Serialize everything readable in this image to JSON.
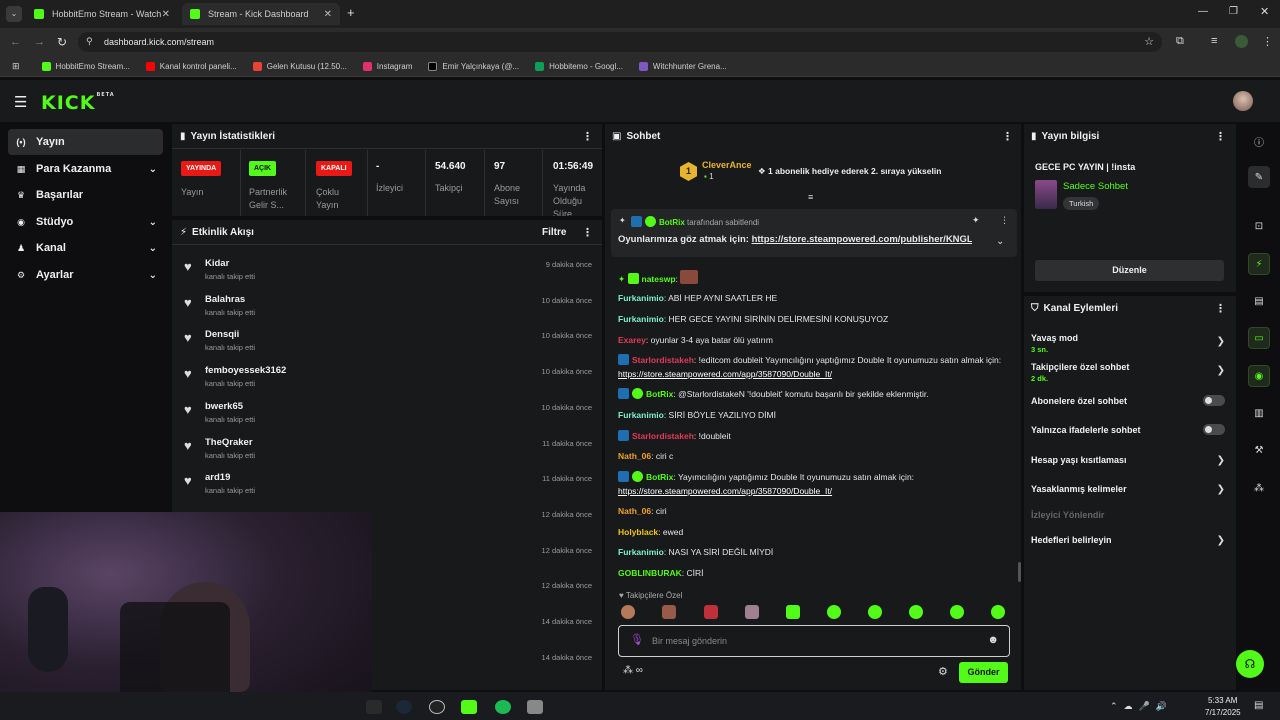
{
  "browser": {
    "tabs": [
      {
        "title": "HobbitEmo Stream - Watch Liv",
        "active": false
      },
      {
        "title": "Stream - Kick Dashboard",
        "active": true
      }
    ],
    "new_tab": "+",
    "url": "dashboard.kick.com/stream",
    "bookmarks": [
      {
        "label": "HobbitEmo Stream...",
        "color": "#53fc18"
      },
      {
        "label": "Kanal kontrol paneli...",
        "color": "#ff0000"
      },
      {
        "label": "Gelen Kutusu (12.50...",
        "color": "#ea4335"
      },
      {
        "label": "Instagram",
        "color": "#e1306c"
      },
      {
        "label": "Emir Yalçınkaya (@...",
        "color": "#000000"
      },
      {
        "label": "Hobbitemo - Googl...",
        "color": "#0f9d58"
      },
      {
        "label": "Witchhunter Grena...",
        "color": "#7e57c2"
      }
    ]
  },
  "kick": {
    "logo": "KICK",
    "logo_beta": "BETA",
    "accent": "#53fc18"
  },
  "nav": [
    {
      "label": "Yayın",
      "icon": "broadcast-icon",
      "glyph": "(•)",
      "active": true,
      "expand": false
    },
    {
      "label": "Para Kazanma",
      "icon": "money-icon",
      "glyph": "▦",
      "active": false,
      "expand": true
    },
    {
      "label": "Başarılar",
      "icon": "trophy-icon",
      "glyph": "🏆",
      "active": false,
      "expand": false
    },
    {
      "label": "Stüdyo",
      "icon": "studio-icon",
      "glyph": "◉",
      "active": false,
      "expand": true
    },
    {
      "label": "Kanal",
      "icon": "channel-icon",
      "glyph": "♟",
      "active": false,
      "expand": true
    },
    {
      "label": "Ayarlar",
      "icon": "settings-icon",
      "glyph": "⚙",
      "active": false,
      "expand": true
    }
  ],
  "stats": {
    "title": "Yayın İstatistikleri",
    "items": [
      {
        "badge": "YAYINDA",
        "badge_color": "#e91916",
        "label": "Yayın"
      },
      {
        "badge": "AÇIK",
        "badge_color": "#53fc18",
        "label": "Partnerlik Gelir S..."
      },
      {
        "badge": "KAPALI",
        "badge_color": "#e91916",
        "label": "Çoklu Yayın"
      },
      {
        "value": "-",
        "label": "İzleyici"
      },
      {
        "value": "54.640",
        "label": "Takipçi"
      },
      {
        "value": "97",
        "label": "Abone Sayısı"
      },
      {
        "value": "01:56:49",
        "label": "Yayında Olduğu Süre"
      }
    ]
  },
  "activity": {
    "title": "Etkinlik Akışı",
    "filter": "Filtre",
    "items": [
      {
        "name": "Kidar",
        "sub": "kanalı takip etti",
        "time": "9 dakika önce"
      },
      {
        "name": "Balahras",
        "sub": "kanalı takip etti",
        "time": "10 dakika önce"
      },
      {
        "name": "Densqii",
        "sub": "kanalı takip etti",
        "time": "10 dakika önce"
      },
      {
        "name": "femboyessek3162",
        "sub": "kanalı takip etti",
        "time": "10 dakika önce"
      },
      {
        "name": "bwerk65",
        "sub": "kanalı takip etti",
        "time": "10 dakika önce"
      },
      {
        "name": "TheQraker",
        "sub": "kanalı takip etti",
        "time": "11 dakika önce"
      },
      {
        "name": "ard19",
        "sub": "kanalı takip etti",
        "time": "11 dakika önce"
      },
      {
        "name": "",
        "sub": "",
        "time": "12 dakika önce"
      },
      {
        "name": "",
        "sub": "",
        "time": "12 dakika önce"
      },
      {
        "name": "",
        "sub": "",
        "time": "12 dakika önce"
      },
      {
        "name": "",
        "sub": "",
        "time": "14 dakika önce"
      },
      {
        "name": "",
        "sub": "",
        "time": "14 dakika önce"
      }
    ]
  },
  "chat": {
    "title": "Sohbet",
    "gift": {
      "rank": "1",
      "user": "CleverAnce",
      "count": "1",
      "text": "1 abonelik hediye ederek 2. sıraya yükselin"
    },
    "pinned": {
      "by": "BotRix",
      "by_suffix": "tarafından sabitlendi",
      "text": "Oyunlarımıza göz atmak için:",
      "link": "https://store.steampowered.com/publisher/KNGL"
    },
    "messages": [
      {
        "user": "nateswp",
        "color": "#53fc18",
        "text": ""
      },
      {
        "user": "Furkanimio",
        "color": "#7bf2c9",
        "text": "ABİ HEP AYNI SAATLER HE"
      },
      {
        "user": "Furkanimio",
        "color": "#7bf2c9",
        "text": "HER GECE YAYINI SİRİNİN DELİRMESİNİ KONUŞUYOZ"
      },
      {
        "user": "Exarey",
        "color": "#e33a5a",
        "text": "oyunlar 3-4 aya batar ölü yatırım"
      },
      {
        "user": "Starlordistakeh",
        "color": "#e33a5a",
        "text": "!editcom doubleit Yayımcılığını yaptığımız Double It oyunumuzu satın almak için:",
        "link": "https://store.steampowered.com/app/3587090/Double_It/"
      },
      {
        "user": "BotRix",
        "color": "#53fc18",
        "text": "@StarlordistakeN '!doubleit' komutu başarılı bir şekilde eklenmiştir."
      },
      {
        "user": "Furkanimio",
        "color": "#7bf2c9",
        "text": "SİRİ BÖYLE YAZILIYO DİMİ"
      },
      {
        "user": "Starlordistakeh",
        "color": "#e33a5a",
        "text": "!doubleit"
      },
      {
        "user": "Nath_06",
        "color": "#f0a030",
        "text": "ciri c"
      },
      {
        "user": "BotRix",
        "color": "#53fc18",
        "text": "Yayımcılığını yaptığımız Double It oyunumuzu satın almak için:",
        "link": "https://store.steampowered.com/app/3587090/Double_It/"
      },
      {
        "user": "Nath_06",
        "color": "#f0a030",
        "text": "ciri"
      },
      {
        "user": "Holyblack",
        "color": "#f0c419",
        "text": "ewed"
      },
      {
        "user": "Furkanimio",
        "color": "#7bf2c9",
        "text": "NASI YA SİRİ DEĞİL MİYDİ"
      },
      {
        "user": "GOBLINBURAK",
        "color": "#53fc18",
        "text": "CİRİ"
      }
    ],
    "followers_only": "Takipçilere Özel",
    "input_placeholder": "Bir mesaj gönderin",
    "send": "Gönder"
  },
  "stream_info": {
    "title": "Yayın bilgisi",
    "stream_title": "GECE PC YAYIN | !insta",
    "category": "Sadece Sohbet",
    "tag": "Turkish",
    "edit": "Düzenle"
  },
  "channel_actions": {
    "title": "Kanal Eylemleri",
    "items": [
      {
        "label": "Yavaş mod",
        "sub": "3 sn.",
        "control": "chevron"
      },
      {
        "label": "Takipçilere özel sohbet",
        "sub": "2 dk.",
        "control": "chevron"
      },
      {
        "label": "Abonelere özel sohbet",
        "sub": "",
        "control": "toggle"
      },
      {
        "label": "Yalnızca ifadelerle sohbet",
        "sub": "",
        "control": "toggle"
      },
      {
        "label": "Hesap yaşı kısıtlaması",
        "sub": "",
        "control": "chevron"
      },
      {
        "label": "Yasaklanmış kelimeler",
        "sub": "",
        "control": "chevron"
      },
      {
        "label": "İzleyici Yönlendir",
        "sub": "",
        "control": "none",
        "disabled": true
      },
      {
        "label": "Hedefleri belirleyin",
        "sub": "",
        "control": "chevron"
      }
    ]
  },
  "taskbar": {
    "time": "5:33 AM",
    "date": "7/17/2025"
  }
}
